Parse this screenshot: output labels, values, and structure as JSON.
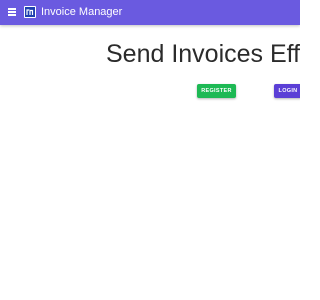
{
  "appbar": {
    "title": "Invoice Manager",
    "background_color": "#6a5ae0",
    "menu_icon": "hamburger-menu-icon",
    "logo_icon": "app-logo-icon"
  },
  "hero": {
    "title": "Send Invoices Eff"
  },
  "actions": {
    "register_label": "REGISTER",
    "register_color": "#1db954",
    "login_label": "LOGIN",
    "login_color": "#5b3fd6"
  }
}
